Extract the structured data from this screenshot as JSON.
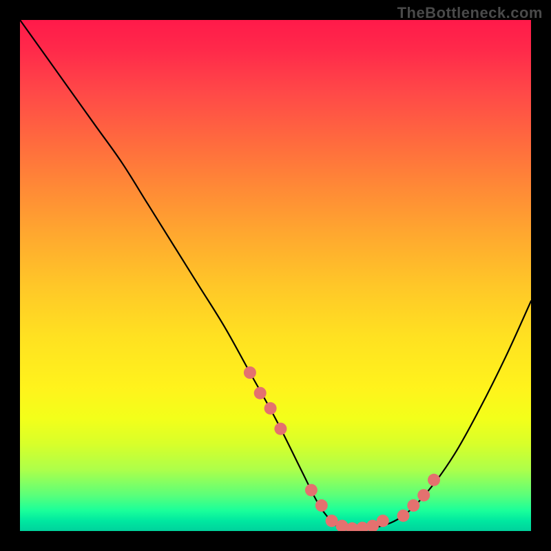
{
  "watermark": "TheBottleneck.com",
  "chart_data": {
    "type": "line",
    "title": "",
    "xlabel": "",
    "ylabel": "",
    "xlim": [
      0,
      100
    ],
    "ylim": [
      0,
      100
    ],
    "curve": {
      "x": [
        0,
        5,
        10,
        15,
        20,
        25,
        30,
        35,
        40,
        45,
        50,
        55,
        58,
        60,
        62,
        65,
        70,
        75,
        80,
        85,
        90,
        95,
        100
      ],
      "y": [
        100,
        93,
        86,
        79,
        72,
        64,
        56,
        48,
        40,
        31,
        22,
        12,
        6,
        3,
        1,
        0.5,
        0.8,
        3,
        8,
        15,
        24,
        34,
        45
      ]
    },
    "highlighted_points": {
      "x": [
        45,
        47,
        49,
        51,
        57,
        59,
        61,
        63,
        65,
        67,
        69,
        71,
        75,
        77,
        79,
        81
      ],
      "y": [
        31,
        27,
        24,
        20,
        8,
        5,
        2,
        1,
        0.5,
        0.6,
        1,
        2,
        3,
        5,
        7,
        10
      ]
    },
    "background": "vertical rainbow gradient red→yellow→green",
    "marker_color": "#e4716f",
    "line_color": "#000000"
  }
}
